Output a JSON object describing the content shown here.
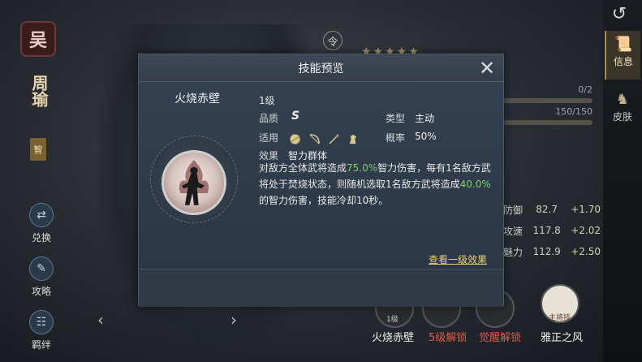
{
  "background": {
    "faction": "吴",
    "general_name": "周瑜",
    "attribute_tag": "智",
    "side_buttons": [
      {
        "label": "兑换",
        "icon": "exchange-icon"
      },
      {
        "label": "攻略",
        "icon": "guide-icon"
      },
      {
        "label": "羁绊",
        "icon": "bond-icon"
      }
    ],
    "tabs": [
      {
        "label": "信息",
        "icon": "scroll-icon",
        "active": true
      },
      {
        "label": "皮肤",
        "icon": "skin-icon",
        "active": false
      }
    ],
    "ling": "令",
    "stars": "★★★★★",
    "progress": [
      {
        "text": "0/2"
      },
      {
        "text": "150/150"
      }
    ],
    "stats": [
      {
        "label": "防御",
        "value": "82.7",
        "plus": "+1.70"
      },
      {
        "label": "攻速",
        "value": "117.8",
        "plus": "+2.02"
      },
      {
        "label": "魅力",
        "value": "112.9",
        "plus": "+2.50"
      }
    ],
    "bottom": {
      "level_badge": "1级",
      "skills": [
        {
          "label": "火烧赤壁",
          "color": "#f0f0f0"
        },
        {
          "label": "5级解锁",
          "color": "#e05a4a"
        },
        {
          "label": "觉醒解锁",
          "color": "#e05a4a"
        },
        {
          "label": "雅正之风",
          "color": "#f0f0f0"
        }
      ],
      "captain_tag": "主将技"
    }
  },
  "modal": {
    "title": "技能预览",
    "skill_name": "火烧赤壁",
    "level": "1级",
    "quality_label": "品质",
    "quality_value": "S",
    "type_label": "类型",
    "type_value": "主动",
    "apply_label": "适用",
    "weapons": [
      "shield-icon",
      "bow-icon",
      "spear-icon",
      "horse-icon"
    ],
    "rate_label": "概率",
    "rate_value": "50%",
    "effect_label": "效果",
    "effect_value": "智力群体",
    "desc_part1": "对敌方全体武将造成",
    "desc_pct1": "75.0%",
    "desc_part2": "智力伤害，每有1名敌方武将处于焚烧状态，则随机选取1名敌方武将造成",
    "desc_pct2": "40.0%",
    "desc_part3": "的智力伤害，技能冷却10秒。",
    "level_link": "查看一级效果"
  }
}
